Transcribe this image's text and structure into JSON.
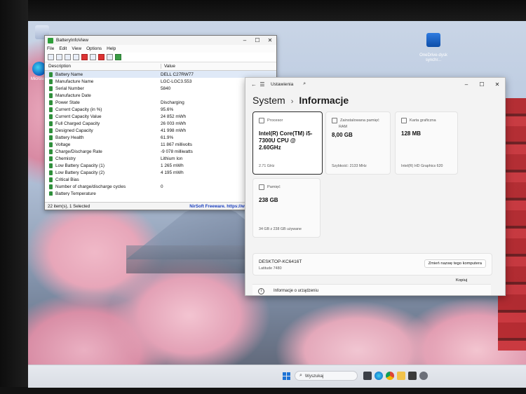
{
  "desktop": {
    "icons": [
      {
        "name": "recycle-bin",
        "label": ""
      },
      {
        "name": "microsoft-edge",
        "label": "Microsoft"
      },
      {
        "name": "onedrive",
        "label": "OneDrive-dysk\nsynchr..."
      }
    ]
  },
  "battery_window": {
    "title": "BatteryInfoView",
    "menu": [
      "File",
      "Edit",
      "View",
      "Options",
      "Help"
    ],
    "columns": {
      "description": "Description",
      "value": "Value"
    },
    "rows": [
      {
        "desc": "Battery Name",
        "value": "DELL C27RW77"
      },
      {
        "desc": "Manufacture Name",
        "value": "LGC-LGC3.553"
      },
      {
        "desc": "Serial Number",
        "value": "5840"
      },
      {
        "desc": "Manufacture Date",
        "value": ""
      },
      {
        "desc": "Power State",
        "value": "Discharging"
      },
      {
        "desc": "Current Capacity (in %)",
        "value": "95.6%"
      },
      {
        "desc": "Current Capacity Value",
        "value": "24 852 mWh"
      },
      {
        "desc": "Full Charged Capacity",
        "value": "26 003 mWh"
      },
      {
        "desc": "Designed Capacity",
        "value": "41 998 mWh"
      },
      {
        "desc": "Battery Health",
        "value": "61.9%"
      },
      {
        "desc": "Voltage",
        "value": "11 867 millivolts"
      },
      {
        "desc": "Charge/Discharge Rate",
        "value": "-9 078 milliwatts"
      },
      {
        "desc": "Chemistry",
        "value": "Lithium Ion"
      },
      {
        "desc": "Low Battery Capacity (1)",
        "value": "1 265 mWh"
      },
      {
        "desc": "Low Battery Capacity (2)",
        "value": "4 195 mWh"
      },
      {
        "desc": "Critical Bias",
        "value": ""
      },
      {
        "desc": "Number of charge/discharge cycles",
        "value": "0"
      },
      {
        "desc": "Battery Temperature",
        "value": ""
      }
    ],
    "status_left": "22 item(s), 1 Selected",
    "status_right": "NirSoft Freeware. https://www.nirsoft.ne"
  },
  "settings_window": {
    "app_title": "Ustawienia",
    "breadcrumb": {
      "parent": "System",
      "separator": "›",
      "current": "Informacje"
    },
    "cards": [
      {
        "label": "Procesor",
        "sub": "",
        "value": "Intel(R) Core(TM) i5-7300U CPU @ 2.60GHz",
        "foot": "2.71 GHz"
      },
      {
        "label": "Zainstalowana pamięć",
        "sub": "RAM",
        "value": "8,00 GB",
        "foot": "Szybkość: 2133 MHz"
      },
      {
        "label": "Karta graficzna",
        "sub": "",
        "value": "128 MB",
        "foot": "Intel(R) HD Graphics 620"
      },
      {
        "label": "Pamięć",
        "sub": "",
        "value": "238 GB",
        "foot": "34 GB z 238 GB używane"
      }
    ],
    "device": {
      "name": "DESKTOP-KC6416T",
      "model": "Latitude 7480",
      "rename_button": "Zmień nazwę tego komputera"
    },
    "copy_button": "Kopiuj",
    "info_section": "Informacje o urządzeniu"
  },
  "taskbar": {
    "search_placeholder": "Wyszukaj",
    "apps": [
      "task-view",
      "edge",
      "chrome",
      "file-explorer",
      "store",
      "settings"
    ]
  }
}
